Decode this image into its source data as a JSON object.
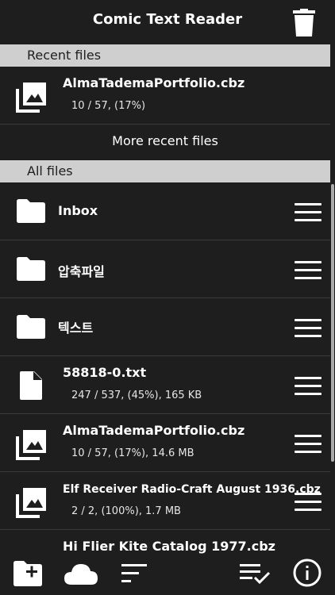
{
  "header": {
    "title": "Comic Text Reader",
    "trash_icon": "trash-icon"
  },
  "recent": {
    "label": "Recent files",
    "items": [
      {
        "name": "AlmaTademaPortfolio.cbz",
        "meta": "10 / 57, (17%)",
        "icon": "image-stack-icon"
      }
    ],
    "more_label": "More recent files"
  },
  "all": {
    "label": "All files",
    "folders": [
      {
        "name": "Inbox",
        "icon": "folder-icon"
      },
      {
        "name": "압축파일",
        "icon": "folder-icon"
      },
      {
        "name": "텍스트",
        "icon": "folder-icon"
      }
    ],
    "files": [
      {
        "name": "58818-0.txt",
        "meta": "247 / 537, (45%), 165 KB",
        "icon": "document-icon"
      },
      {
        "name": "AlmaTademaPortfolio.cbz",
        "meta": "10 / 57, (17%), 14.6 MB",
        "icon": "image-stack-icon"
      },
      {
        "name": "Elf Receiver Radio-Craft August 1936.cbz",
        "meta": "2 / 2, (100%), 1.7 MB",
        "icon": "image-stack-icon"
      },
      {
        "name": "Hi Flier Kite Catalog 1977.cbz",
        "meta": "",
        "icon": "image-stack-icon"
      }
    ]
  },
  "toolbar": {
    "icons": [
      "add-folder-icon",
      "cloud-icon",
      "sort-icon",
      "select-list-icon",
      "info-icon"
    ]
  }
}
